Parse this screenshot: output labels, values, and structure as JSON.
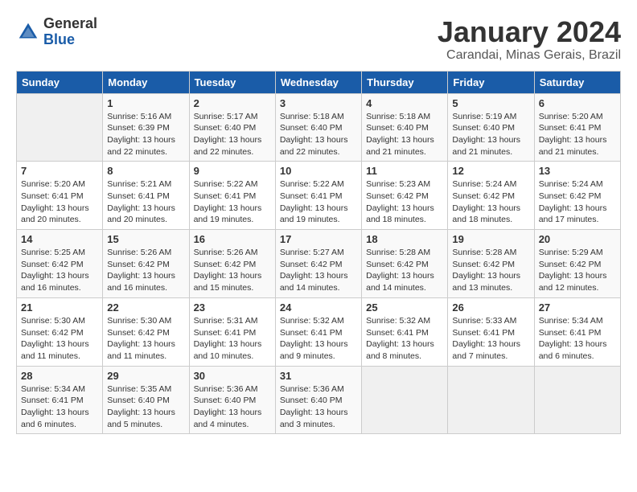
{
  "header": {
    "logo_general": "General",
    "logo_blue": "Blue",
    "month_title": "January 2024",
    "location": "Carandai, Minas Gerais, Brazil"
  },
  "days_of_week": [
    "Sunday",
    "Monday",
    "Tuesday",
    "Wednesday",
    "Thursday",
    "Friday",
    "Saturday"
  ],
  "weeks": [
    [
      {
        "day": "",
        "empty": true
      },
      {
        "day": "1",
        "sunrise": "5:16 AM",
        "sunset": "6:39 PM",
        "daylight": "13 hours and 22 minutes."
      },
      {
        "day": "2",
        "sunrise": "5:17 AM",
        "sunset": "6:40 PM",
        "daylight": "13 hours and 22 minutes."
      },
      {
        "day": "3",
        "sunrise": "5:18 AM",
        "sunset": "6:40 PM",
        "daylight": "13 hours and 22 minutes."
      },
      {
        "day": "4",
        "sunrise": "5:18 AM",
        "sunset": "6:40 PM",
        "daylight": "13 hours and 21 minutes."
      },
      {
        "day": "5",
        "sunrise": "5:19 AM",
        "sunset": "6:40 PM",
        "daylight": "13 hours and 21 minutes."
      },
      {
        "day": "6",
        "sunrise": "5:20 AM",
        "sunset": "6:41 PM",
        "daylight": "13 hours and 21 minutes."
      }
    ],
    [
      {
        "day": "7",
        "sunrise": "5:20 AM",
        "sunset": "6:41 PM",
        "daylight": "13 hours and 20 minutes."
      },
      {
        "day": "8",
        "sunrise": "5:21 AM",
        "sunset": "6:41 PM",
        "daylight": "13 hours and 20 minutes."
      },
      {
        "day": "9",
        "sunrise": "5:22 AM",
        "sunset": "6:41 PM",
        "daylight": "13 hours and 19 minutes."
      },
      {
        "day": "10",
        "sunrise": "5:22 AM",
        "sunset": "6:41 PM",
        "daylight": "13 hours and 19 minutes."
      },
      {
        "day": "11",
        "sunrise": "5:23 AM",
        "sunset": "6:42 PM",
        "daylight": "13 hours and 18 minutes."
      },
      {
        "day": "12",
        "sunrise": "5:24 AM",
        "sunset": "6:42 PM",
        "daylight": "13 hours and 18 minutes."
      },
      {
        "day": "13",
        "sunrise": "5:24 AM",
        "sunset": "6:42 PM",
        "daylight": "13 hours and 17 minutes."
      }
    ],
    [
      {
        "day": "14",
        "sunrise": "5:25 AM",
        "sunset": "6:42 PM",
        "daylight": "13 hours and 16 minutes."
      },
      {
        "day": "15",
        "sunrise": "5:26 AM",
        "sunset": "6:42 PM",
        "daylight": "13 hours and 16 minutes."
      },
      {
        "day": "16",
        "sunrise": "5:26 AM",
        "sunset": "6:42 PM",
        "daylight": "13 hours and 15 minutes."
      },
      {
        "day": "17",
        "sunrise": "5:27 AM",
        "sunset": "6:42 PM",
        "daylight": "13 hours and 14 minutes."
      },
      {
        "day": "18",
        "sunrise": "5:28 AM",
        "sunset": "6:42 PM",
        "daylight": "13 hours and 14 minutes."
      },
      {
        "day": "19",
        "sunrise": "5:28 AM",
        "sunset": "6:42 PM",
        "daylight": "13 hours and 13 minutes."
      },
      {
        "day": "20",
        "sunrise": "5:29 AM",
        "sunset": "6:42 PM",
        "daylight": "13 hours and 12 minutes."
      }
    ],
    [
      {
        "day": "21",
        "sunrise": "5:30 AM",
        "sunset": "6:42 PM",
        "daylight": "13 hours and 11 minutes."
      },
      {
        "day": "22",
        "sunrise": "5:30 AM",
        "sunset": "6:42 PM",
        "daylight": "13 hours and 11 minutes."
      },
      {
        "day": "23",
        "sunrise": "5:31 AM",
        "sunset": "6:41 PM",
        "daylight": "13 hours and 10 minutes."
      },
      {
        "day": "24",
        "sunrise": "5:32 AM",
        "sunset": "6:41 PM",
        "daylight": "13 hours and 9 minutes."
      },
      {
        "day": "25",
        "sunrise": "5:32 AM",
        "sunset": "6:41 PM",
        "daylight": "13 hours and 8 minutes."
      },
      {
        "day": "26",
        "sunrise": "5:33 AM",
        "sunset": "6:41 PM",
        "daylight": "13 hours and 7 minutes."
      },
      {
        "day": "27",
        "sunrise": "5:34 AM",
        "sunset": "6:41 PM",
        "daylight": "13 hours and 6 minutes."
      }
    ],
    [
      {
        "day": "28",
        "sunrise": "5:34 AM",
        "sunset": "6:41 PM",
        "daylight": "13 hours and 6 minutes."
      },
      {
        "day": "29",
        "sunrise": "5:35 AM",
        "sunset": "6:40 PM",
        "daylight": "13 hours and 5 minutes."
      },
      {
        "day": "30",
        "sunrise": "5:36 AM",
        "sunset": "6:40 PM",
        "daylight": "13 hours and 4 minutes."
      },
      {
        "day": "31",
        "sunrise": "5:36 AM",
        "sunset": "6:40 PM",
        "daylight": "13 hours and 3 minutes."
      },
      {
        "day": "",
        "empty": true
      },
      {
        "day": "",
        "empty": true
      },
      {
        "day": "",
        "empty": true
      }
    ]
  ]
}
